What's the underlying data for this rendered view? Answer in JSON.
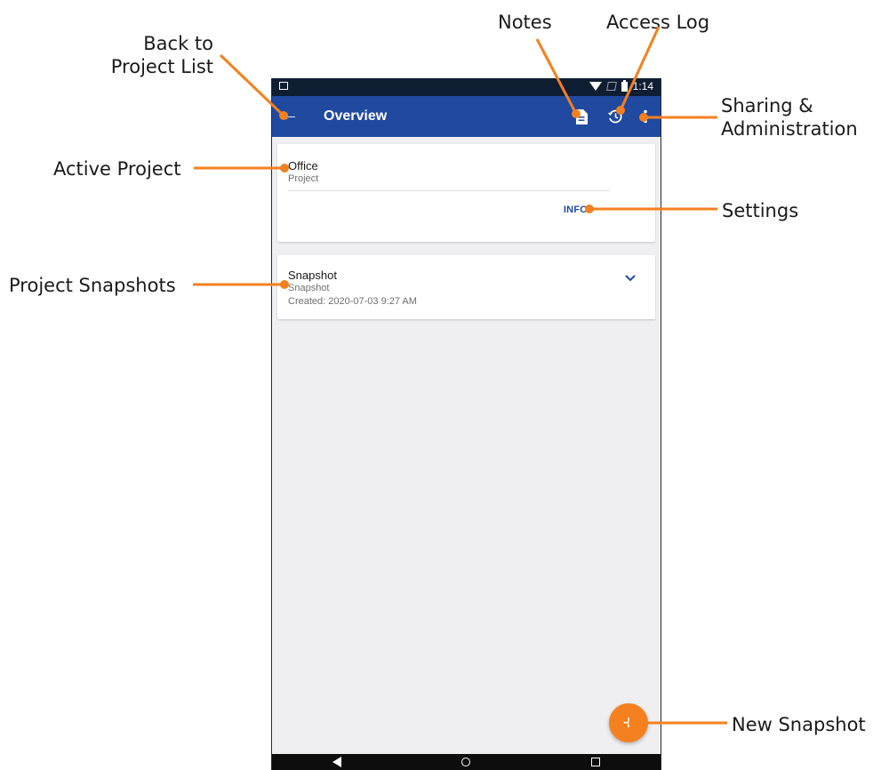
{
  "callouts": {
    "back": [
      "Back to",
      "Project List"
    ],
    "notes": "Notes",
    "access_log": "Access Log",
    "sharing": [
      "Sharing &",
      "Administration"
    ],
    "active_project": "Active Project",
    "settings": "Settings",
    "snapshots": "Project Snapshots",
    "new_snapshot": "New Snapshot"
  },
  "statusbar": {
    "time": "1:14"
  },
  "appbar": {
    "back_icon": "←",
    "title": "Overview"
  },
  "project_card": {
    "name": "Office",
    "type": "Project",
    "info_label": "INFO"
  },
  "snapshot_card": {
    "name": "Snapshot",
    "type": "Snapshot",
    "created": "Created: 2020-07-03 9:27 AM",
    "expand_icon": "⌄"
  },
  "fab": {
    "label": "+"
  },
  "colors": {
    "appbar": "#2049a0",
    "accent": "#f5801f",
    "statusbar": "#0f1e33"
  }
}
